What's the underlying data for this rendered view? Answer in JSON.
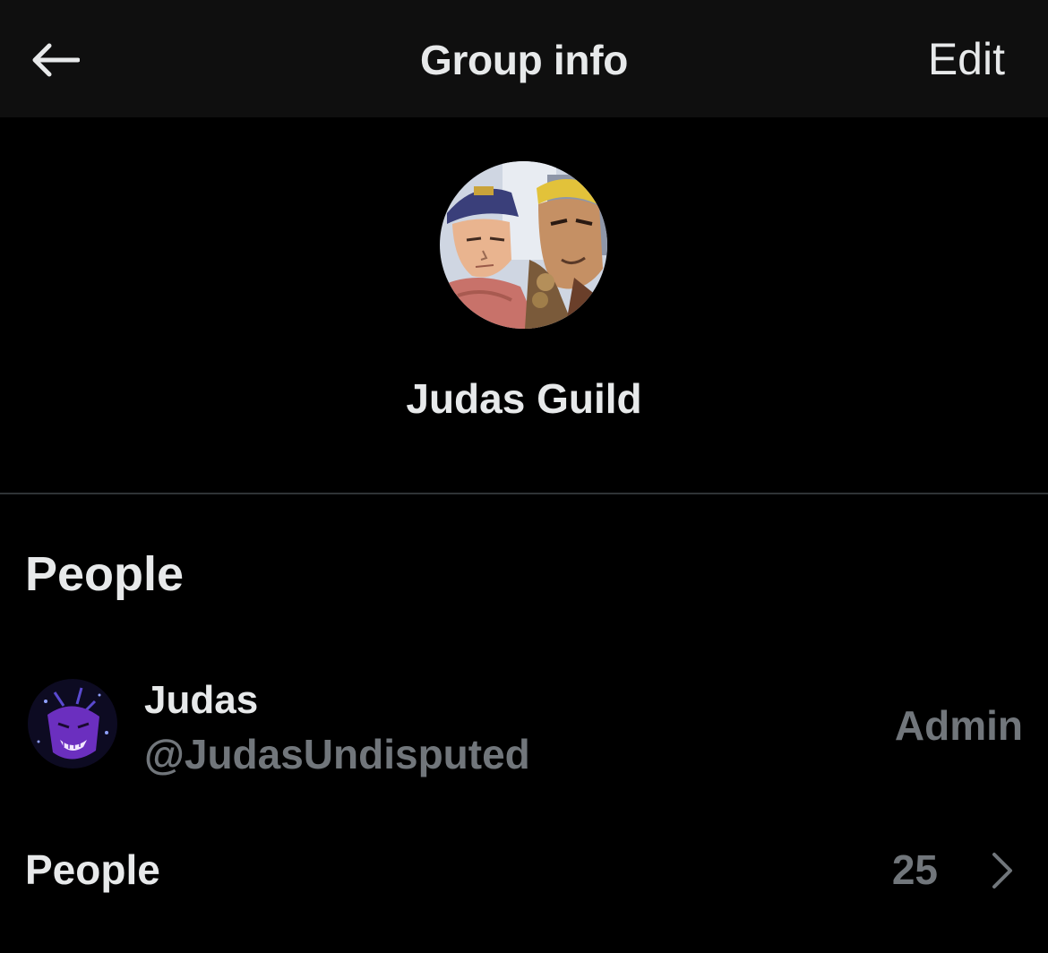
{
  "header": {
    "title": "Group info",
    "edit_label": "Edit",
    "back_icon": "arrow-left-icon"
  },
  "group": {
    "name": "Judas Guild",
    "avatar": "group-avatar-anime-characters"
  },
  "people_section": {
    "heading": "People",
    "members": [
      {
        "name": "Judas",
        "handle": "@JudasUndisputed",
        "role": "Admin",
        "avatar": "purple-character-avatar"
      }
    ],
    "people_row": {
      "label": "People",
      "count": "25",
      "icon": "chevron-right-icon"
    }
  },
  "colors": {
    "background": "#000000",
    "header_background": "#0f0f0f",
    "primary_text": "#e7e9ea",
    "secondary_text": "#71767b",
    "divider": "#2f3336"
  }
}
